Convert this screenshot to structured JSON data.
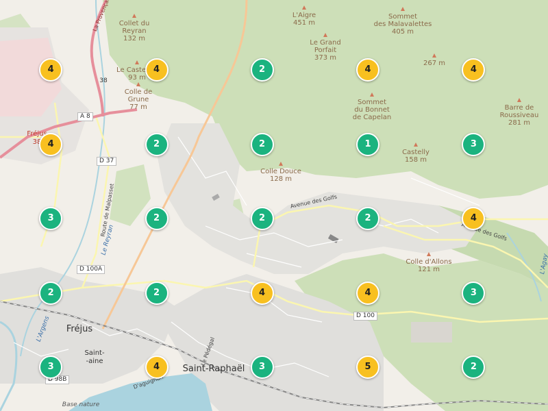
{
  "colors": {
    "cluster_green": "#1bb37f",
    "cluster_yellow": "#f8c020",
    "forest": "#cddfb8",
    "urban": "#e0dfdc",
    "water": "#aad3df",
    "road_major": "#f7c796",
    "road_red": "#e68f9b"
  },
  "clusters": [
    {
      "count": "4",
      "lat": 43.4723,
      "lon": 6.7245
    },
    {
      "count": "4",
      "lat": 43.4723,
      "lon": 6.7568
    },
    {
      "count": "2",
      "lat": 43.4723,
      "lon": 6.789
    },
    {
      "count": "4",
      "lat": 43.4723,
      "lon": 6.8213
    },
    {
      "count": "4",
      "lat": 43.4723,
      "lon": 6.8536
    },
    {
      "count": "4",
      "lat": 43.4534,
      "lon": 6.7245
    },
    {
      "count": "2",
      "lat": 43.4534,
      "lon": 6.7568
    },
    {
      "count": "2",
      "lat": 43.4534,
      "lon": 6.789
    },
    {
      "count": "1",
      "lat": 43.4534,
      "lon": 6.8213
    },
    {
      "count": "3",
      "lat": 43.4534,
      "lon": 6.8536
    },
    {
      "count": "3",
      "lat": 43.4345,
      "lon": 6.7245
    },
    {
      "count": "2",
      "lat": 43.4345,
      "lon": 6.7568
    },
    {
      "count": "2",
      "lat": 43.4345,
      "lon": 6.789
    },
    {
      "count": "2",
      "lat": 43.4345,
      "lon": 6.8213
    },
    {
      "count": "4",
      "lat": 43.4345,
      "lon": 6.8536
    },
    {
      "count": "2",
      "lat": 43.4155,
      "lon": 6.7245
    },
    {
      "count": "2",
      "lat": 43.4155,
      "lon": 6.7568
    },
    {
      "count": "4",
      "lat": 43.4155,
      "lon": 6.789
    },
    {
      "count": "4",
      "lat": 43.4155,
      "lon": 6.8213
    },
    {
      "count": "3",
      "lat": 43.4155,
      "lon": 6.8536
    },
    {
      "count": "3",
      "lat": 43.3966,
      "lon": 6.7245
    },
    {
      "count": "4",
      "lat": 43.3966,
      "lon": 6.7568
    },
    {
      "count": "3",
      "lat": 43.3966,
      "lon": 6.789
    },
    {
      "count": "5",
      "lat": 43.3966,
      "lon": 6.8213
    },
    {
      "count": "2",
      "lat": 43.3966,
      "lon": 6.8536
    }
  ],
  "labels": {
    "towns": {
      "frejus": "Fréjus",
      "saint_raphael": "Saint-Raphaël",
      "frejus_small": "Fréjus",
      "frejus_small_num": "38"
    },
    "peaks": [
      {
        "name": "Collet du\nReyran",
        "elev": "132 m"
      },
      {
        "name": "Le Castellas",
        "elev": "93 m"
      },
      {
        "name": "Colle de\nGrune",
        "elev": "77 m"
      },
      {
        "name": "L'Aigre",
        "elev": "451 m"
      },
      {
        "name": "Le Grand\nPorfait",
        "elev": "373 m"
      },
      {
        "name": "Sommet\ndes Malavalettes",
        "elev": "405 m"
      },
      {
        "name": "",
        "elev": "267 m"
      },
      {
        "name": "Sommet\ndu Bonnet\nde Capelan",
        "elev": ""
      },
      {
        "name": "Barre de\nRoussiveau",
        "elev": "281 m"
      },
      {
        "name": "Castelly",
        "elev": "158 m"
      },
      {
        "name": "Colle Douce",
        "elev": "128 m"
      },
      {
        "name": "Colle d'Allons",
        "elev": "121 m"
      }
    ],
    "roads": {
      "a8": "A 8",
      "d37": "D 37",
      "d100a": "D 100A",
      "d100": "D 100",
      "d98b": "D 98B",
      "n38": "38"
    },
    "streets": {
      "golfs1": "Avenue des Golfs",
      "golfs2": "Avenue des Golfs",
      "provencale": "La Provençale",
      "malpasset": "Route de Malpasset",
      "reyran": "Le Reyran",
      "argens": "L'Argens",
      "agay": "L'Agay",
      "saint": "Saint-",
      "aine": "-aine",
      "daguignan": "D'aguignan",
      "pedegal": "Le Pédégal",
      "base": "Base nature"
    }
  }
}
